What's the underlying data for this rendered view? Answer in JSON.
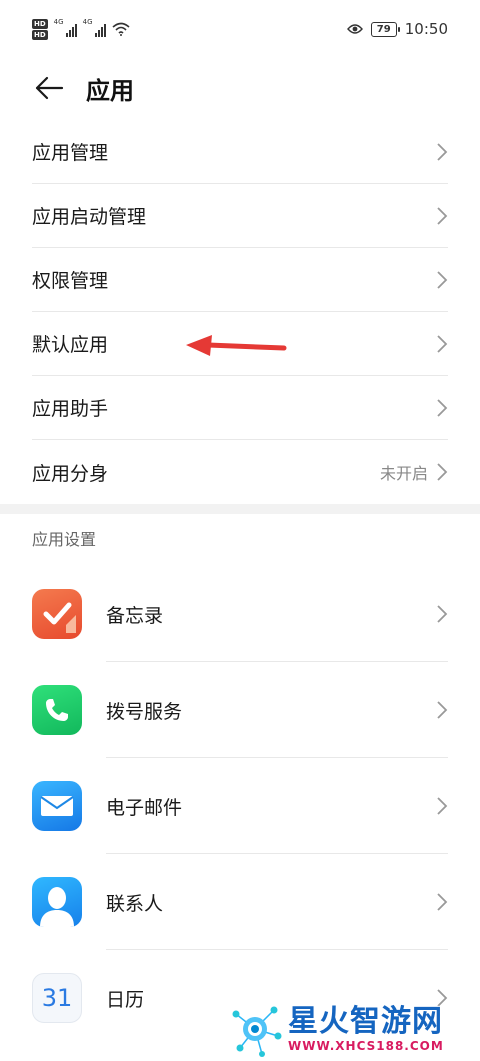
{
  "status_bar": {
    "hd1": "HD",
    "hd2": "HD",
    "net1": "4G",
    "net2": "4G",
    "battery": "79",
    "time": "10:50"
  },
  "header": {
    "back_icon": "arrow-left-icon",
    "title": "应用"
  },
  "menu": {
    "items": [
      {
        "label": "应用管理",
        "value": ""
      },
      {
        "label": "应用启动管理",
        "value": ""
      },
      {
        "label": "权限管理",
        "value": ""
      },
      {
        "label": "默认应用",
        "value": ""
      },
      {
        "label": "应用助手",
        "value": ""
      },
      {
        "label": "应用分身",
        "value": "未开启"
      }
    ]
  },
  "section": {
    "title": "应用设置"
  },
  "apps": [
    {
      "label": "备忘录",
      "icon": "memo-icon"
    },
    {
      "label": "拨号服务",
      "icon": "phone-icon"
    },
    {
      "label": "电子邮件",
      "icon": "mail-icon"
    },
    {
      "label": "联系人",
      "icon": "contacts-icon"
    },
    {
      "label": "日历",
      "icon": "calendar-icon",
      "icon_text": "31"
    }
  ],
  "watermark": {
    "title": "星火智游网",
    "url": "WWW.XHCS188.COM"
  },
  "colors": {
    "annotation_arrow": "#e53935",
    "divider": "#e8e8e8",
    "secondary_text": "#888888"
  }
}
